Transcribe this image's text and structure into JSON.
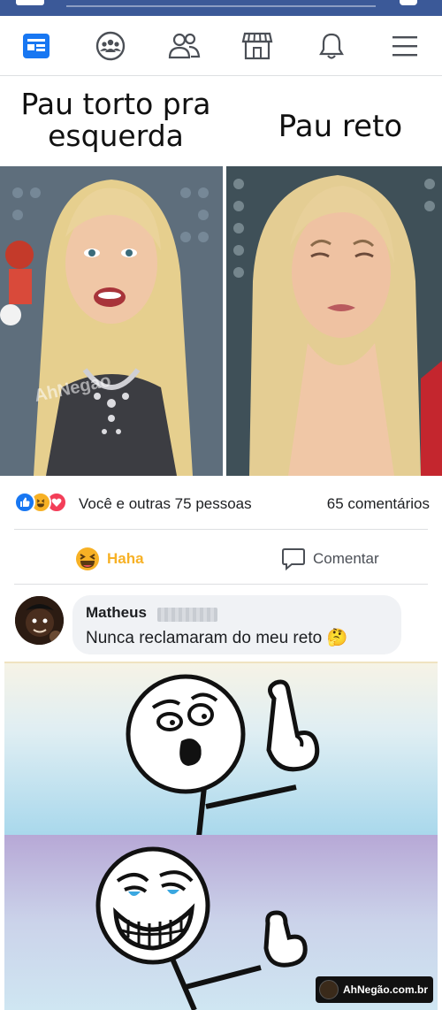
{
  "nav": {
    "items": [
      {
        "name": "news-feed",
        "icon": "news-feed-icon",
        "active": true
      },
      {
        "name": "groups",
        "icon": "groups-icon"
      },
      {
        "name": "friends",
        "icon": "friends-icon"
      },
      {
        "name": "marketplace",
        "icon": "marketplace-icon"
      },
      {
        "name": "notifications",
        "icon": "bell-icon"
      },
      {
        "name": "menu",
        "icon": "hamburger-menu-icon"
      }
    ],
    "accent": "#1877f2"
  },
  "meme": {
    "left_caption": "Pau torto pra esquerda",
    "right_caption": "Pau reto",
    "photo_watermark": "AhNegao"
  },
  "post": {
    "reactions_text": "Você e outras 75 pessoas",
    "comments_count": "65 comentários",
    "reaction_icons": [
      "like-icon",
      "haha-icon",
      "love-icon"
    ],
    "actions": {
      "haha_label": "Haha",
      "comment_label": "Comentar"
    },
    "colors": {
      "haha": "#f7b125",
      "like": "#1877f2",
      "love": "#f33e58"
    }
  },
  "comment": {
    "author": "Matheus",
    "text": "Nunca reclamaram do meu reto",
    "emoji": "🤔"
  },
  "comic": {
    "watermark": "AhNegão.com.br"
  }
}
